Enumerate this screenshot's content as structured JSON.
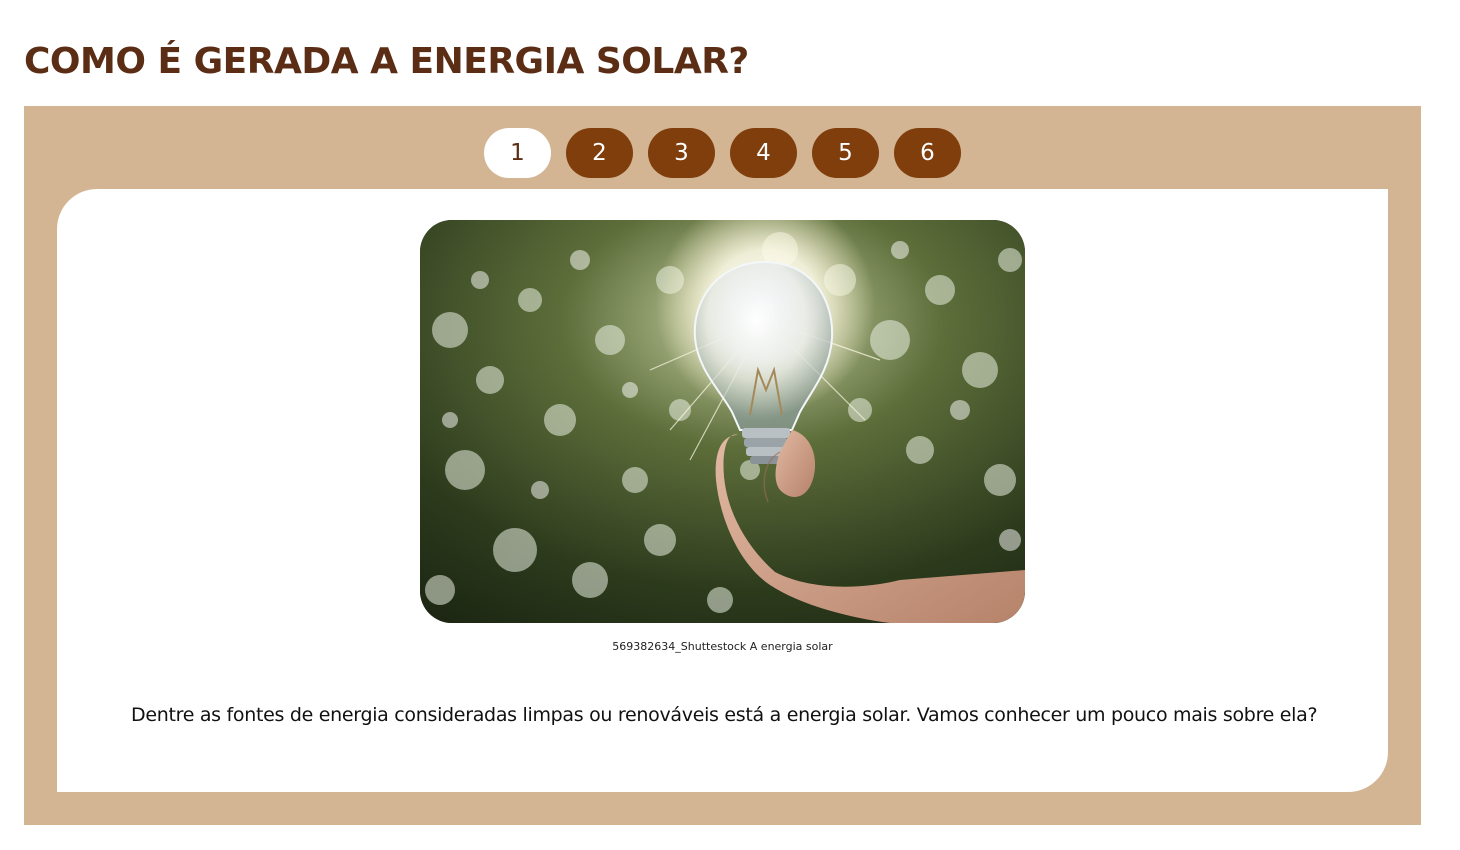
{
  "page": {
    "title": "COMO É GERADA A ENERGIA SOLAR?"
  },
  "carousel": {
    "tabs": [
      {
        "label": "1",
        "active": true
      },
      {
        "label": "2",
        "active": false
      },
      {
        "label": "3",
        "active": false
      },
      {
        "label": "4",
        "active": false
      },
      {
        "label": "5",
        "active": false
      },
      {
        "label": "6",
        "active": false
      }
    ],
    "slide": {
      "image_subject": "hand-holding-light-bulb-in-sunlight",
      "caption": "569382634_Shuttestock A energia solar",
      "text": "Dentre as fontes de energia consideradas limpas ou renováveis está a energia solar. Vamos conhecer um pouco mais sobre ela?"
    }
  },
  "colors": {
    "title": "#5a2d14",
    "carousel_background": "#d4b593",
    "tab_inactive": "#7f3e0c",
    "tab_active": "#ffffff",
    "panel": "#ffffff"
  }
}
